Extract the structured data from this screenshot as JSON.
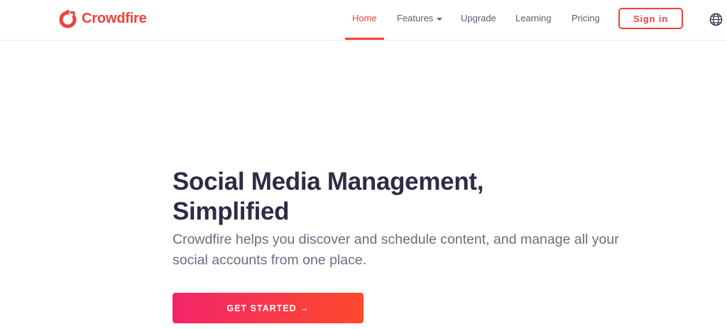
{
  "brand": {
    "name": "Crowdfire",
    "logo": "crowdfire-logo-icon",
    "color": "#f1423a"
  },
  "nav": {
    "items": [
      {
        "label": "Home",
        "active": true
      },
      {
        "label": "Features",
        "dropdown": true
      },
      {
        "label": "Upgrade"
      },
      {
        "label": "Learning"
      },
      {
        "label": "Pricing"
      }
    ],
    "signin_label": "Sign in",
    "language_icon": "globe-icon"
  },
  "hero": {
    "title_line1": "Social Media Management,",
    "title_line2": "Simplified",
    "subtitle": "Crowdfire helps you discover and schedule content, and manage all your social accounts from one place.",
    "cta_label": "GET STARTED →",
    "cta_gradient": [
      "#f3256a",
      "#fd4a2b"
    ]
  },
  "colors": {
    "accent": "#f1423a",
    "heading": "#2d2c45",
    "body_text": "#6d6c82"
  }
}
